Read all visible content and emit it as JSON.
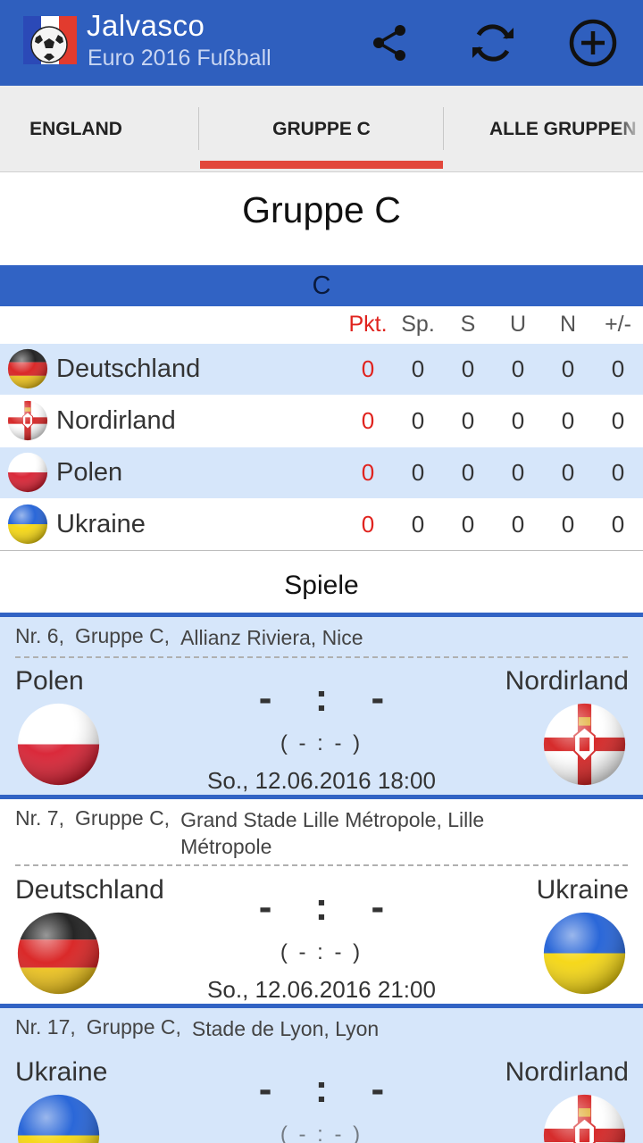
{
  "app": {
    "title": "Jalvasco",
    "subtitle": "Euro 2016 Fußball",
    "actions": [
      "share-icon",
      "refresh-icon",
      "add-icon"
    ]
  },
  "tabs": [
    {
      "label": "ENGLAND",
      "selected": false
    },
    {
      "label": "GRUPPE C",
      "selected": true
    },
    {
      "label": "ALLE GRUPPEN",
      "selected": false
    }
  ],
  "group": {
    "title": "Gruppe C",
    "header": "C"
  },
  "standings": {
    "columns": [
      "Pkt.",
      "Sp.",
      "S",
      "U",
      "N",
      "+/-"
    ],
    "rows": [
      {
        "team": "Deutschland",
        "flag": "flag-germany",
        "values": [
          "0",
          "0",
          "0",
          "0",
          "0",
          "0"
        ]
      },
      {
        "team": "Nordirland",
        "flag": "flag-northern-ireland",
        "values": [
          "0",
          "0",
          "0",
          "0",
          "0",
          "0"
        ]
      },
      {
        "team": "Polen",
        "flag": "flag-poland",
        "values": [
          "0",
          "0",
          "0",
          "0",
          "0",
          "0"
        ]
      },
      {
        "team": "Ukraine",
        "flag": "flag-ukraine",
        "values": [
          "0",
          "0",
          "0",
          "0",
          "0",
          "0"
        ]
      }
    ]
  },
  "matches_title": "Spiele",
  "matches": [
    {
      "nr": "Nr. 6,",
      "group": "Gruppe C,",
      "venue": "Allianz Riviera, Nice",
      "home": "Polen",
      "away": "Nordirland",
      "score": "- : -",
      "halftime": "( - : - )",
      "date": "So., 12.06.2016 18:00",
      "home_flag": "flag-poland",
      "away_flag": "flag-northern-ireland"
    },
    {
      "nr": "Nr. 7,",
      "group": "Gruppe C,",
      "venue": "Grand Stade Lille Métropole, Lille Métropole",
      "home": "Deutschland",
      "away": "Ukraine",
      "score": "- : -",
      "halftime": "( - : - )",
      "date": "So., 12.06.2016 21:00",
      "home_flag": "flag-germany",
      "away_flag": "flag-ukraine"
    },
    {
      "nr": "Nr. 17,",
      "group": "Gruppe C,",
      "venue": "Stade de Lyon, Lyon",
      "home": "Ukraine",
      "away": "Nordirland",
      "score": "- : -",
      "halftime": "( - : - )",
      "date": "",
      "home_flag": "flag-ukraine",
      "away_flag": "flag-northern-ireland"
    }
  ],
  "colors": {
    "primary": "#2f5fbe",
    "accent": "#e2473b",
    "points": "#e0231e",
    "row_alt": "#d6e6fa"
  }
}
